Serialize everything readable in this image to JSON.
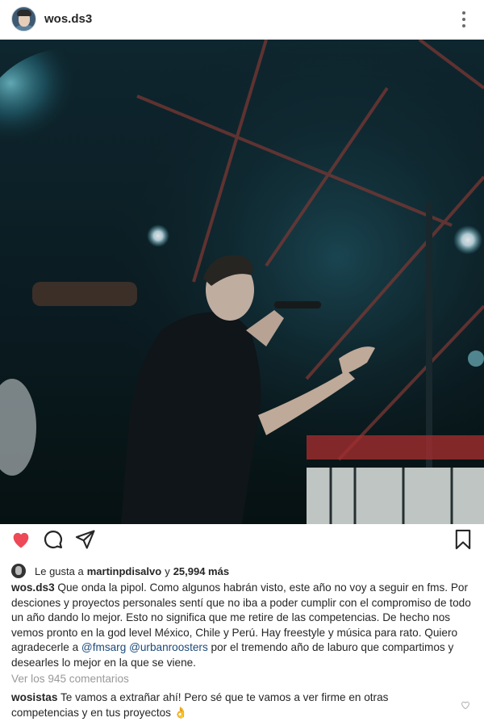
{
  "header": {
    "username": "wos.ds3",
    "avatar_icon": "user-avatar",
    "more_icon": "more-vertical-icon"
  },
  "post": {
    "image_description_icon": "concert-photo"
  },
  "actions": {
    "like_icon": "heart-filled-icon",
    "comment_icon": "comment-icon",
    "share_icon": "send-icon",
    "save_icon": "bookmark-icon",
    "like_color": "#ed4956"
  },
  "likes": {
    "prefix": "Le gusta a",
    "user": "martinpdisalvo",
    "joiner": "y",
    "count": "25,994 más"
  },
  "caption": {
    "username": "wos.ds3",
    "text_part1": "Que onda la pipol. Como algunos habrán visto, este año no voy a seguir en fms. Por desciones y proyectos personales sentí que no iba a poder cumplir con el compromiso de todo un año dando lo mejor. Esto no significa que me retire de las competencias. De hecho nos vemos pronto en la god level México, Chile y Perú. Hay freestyle y música para rato. Quiero agradecerle a",
    "mention1": "@fmsarg",
    "mention2": "@urbanroosters",
    "text_part2": "por el tremendo año de laburo que compartimos  y desearles lo mejor en la que se viene."
  },
  "comments": {
    "view_all": "Ver los 945 comentarios",
    "items": [
      {
        "username": "wosistas",
        "text": "Te vamos a extrañar ahí! Pero sé que te vamos a ver firme en otras competencias y en tus proyectos",
        "emoji": "👌"
      }
    ]
  }
}
